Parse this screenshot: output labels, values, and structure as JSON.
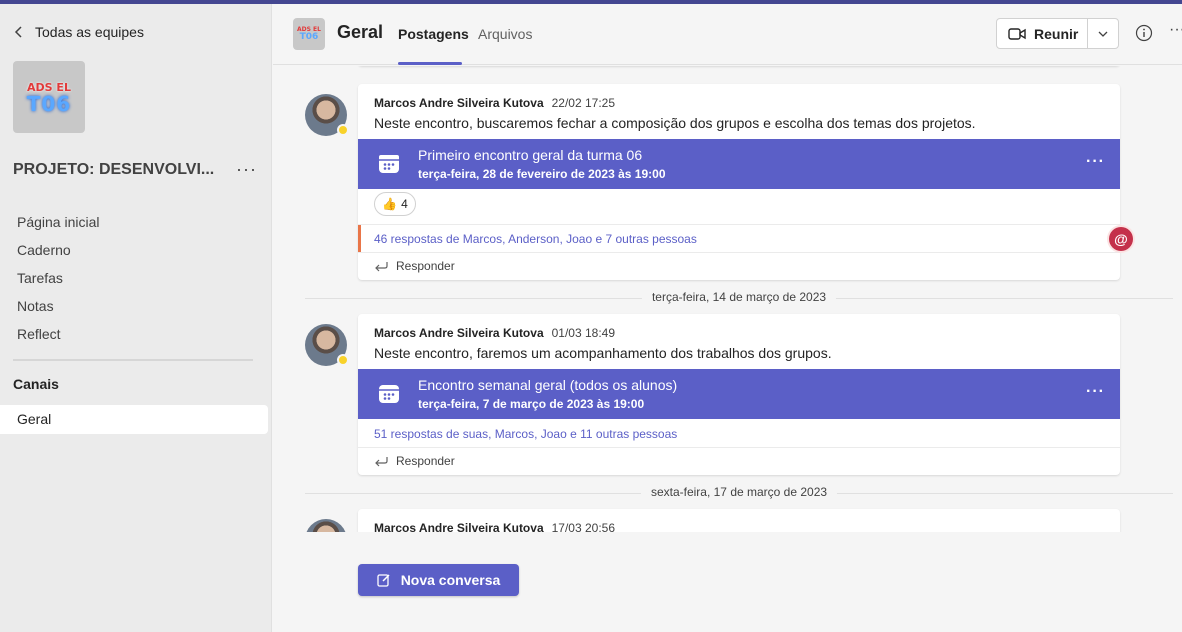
{
  "sidebar": {
    "back_label": "Todas as equipes",
    "team_avatar": {
      "line1": "ADS EL",
      "line2": "T06"
    },
    "team_name": "PROJETO: DESENVOLVI...",
    "team_more": "···",
    "nav_items": [
      "Página inicial",
      "Caderno",
      "Tarefas",
      "Notas",
      "Reflect"
    ],
    "channels_title": "Canais",
    "channels": [
      "Geral"
    ]
  },
  "header": {
    "channel_title": "Geral",
    "tabs": [
      "Postagens",
      "Arquivos"
    ],
    "meet_label": "Reunir",
    "more": "···"
  },
  "posts": [
    {
      "author": "Marcos Andre Silveira Kutova",
      "time": "22/02 17:25",
      "message": "Neste encontro, buscaremos fechar a composição dos grupos e escolha dos temas dos projetos.",
      "event_title": "Primeiro encontro geral da turma 06",
      "event_date": "terça-feira, 28 de fevereiro de 2023 às 19:00",
      "reaction_emoji": "👍",
      "reaction_count": "4",
      "replies": "46 respostas de Marcos, Anderson, Joao e 7 outras pessoas",
      "reply_label": "Responder"
    },
    {
      "author": "Marcos Andre Silveira Kutova",
      "time": "01/03 18:49",
      "message": "Neste encontro, faremos um acompanhamento dos trabalhos dos grupos.",
      "event_title": "Encontro semanal geral (todos os alunos)",
      "event_date": "terça-feira, 7 de março de 2023 às 19:00",
      "replies": "51 respostas de suas, Marcos, Joao e 11 outras pessoas",
      "reply_label": "Responder"
    },
    {
      "author": "Marcos Andre Silveira Kutova",
      "time": "17/03 20:56"
    }
  ],
  "date_separators": [
    "terça-feira, 14 de março de 2023",
    "sexta-feira, 17 de março de 2023"
  ],
  "event_more": "···",
  "mention_symbol": "@",
  "new_conversation_label": "Nova conversa",
  "colors": {
    "brand": "#5b5fc7",
    "top_bar": "#444791",
    "mention": "#c4314b",
    "status_away": "#f8d22a"
  }
}
